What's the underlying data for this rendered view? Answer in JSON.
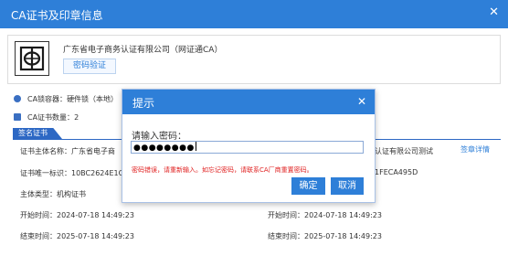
{
  "window": {
    "title": "CA证书及印章信息",
    "close_glyph": "✕"
  },
  "issuer": {
    "name": "广东省电子商务认证有限公司（网证通CA）",
    "verify_button": "密码验证",
    "logo_icon": "netca-logo"
  },
  "info": {
    "container_label": "CA锁容器：",
    "container_value": "硬件锁（本地）",
    "count_label": "CA证书数量：",
    "count_value": "2"
  },
  "tab": {
    "label": "签名证书"
  },
  "cert": {
    "subject_label": "证书主体名称：",
    "subject_value_left": "广东省电子商",
    "subject_value_right": "认证有限公司测试",
    "uid_label": "证书唯一标识：",
    "uid_value_left": "10BC2624E1C5",
    "uid_value_right": "1FECA495D",
    "type_label": "主体类型：",
    "type_value": "机构证书",
    "start_label": "开始时间：",
    "start_value": "2024-07-18 14:49:23",
    "end_label": "结束时间：",
    "end_value": "2025-07-18 14:49:23",
    "start_label_right": "开始时间：",
    "start_value_right": "2024-07-18 14:49:23",
    "end_label_right": "结束时间：",
    "end_value_right": "2025-07-18 14:49:23"
  },
  "links": {
    "sign_detail": "签章详情"
  },
  "dialog": {
    "title": "提示",
    "close_glyph": "✕",
    "prompt": "请输入密码：",
    "password_mask": "●●●●●●●●",
    "error": "密码错误，请重新输入。如忘记密码，请联系CA厂商重置密码。",
    "ok_label": "确定",
    "cancel_label": "取消"
  }
}
